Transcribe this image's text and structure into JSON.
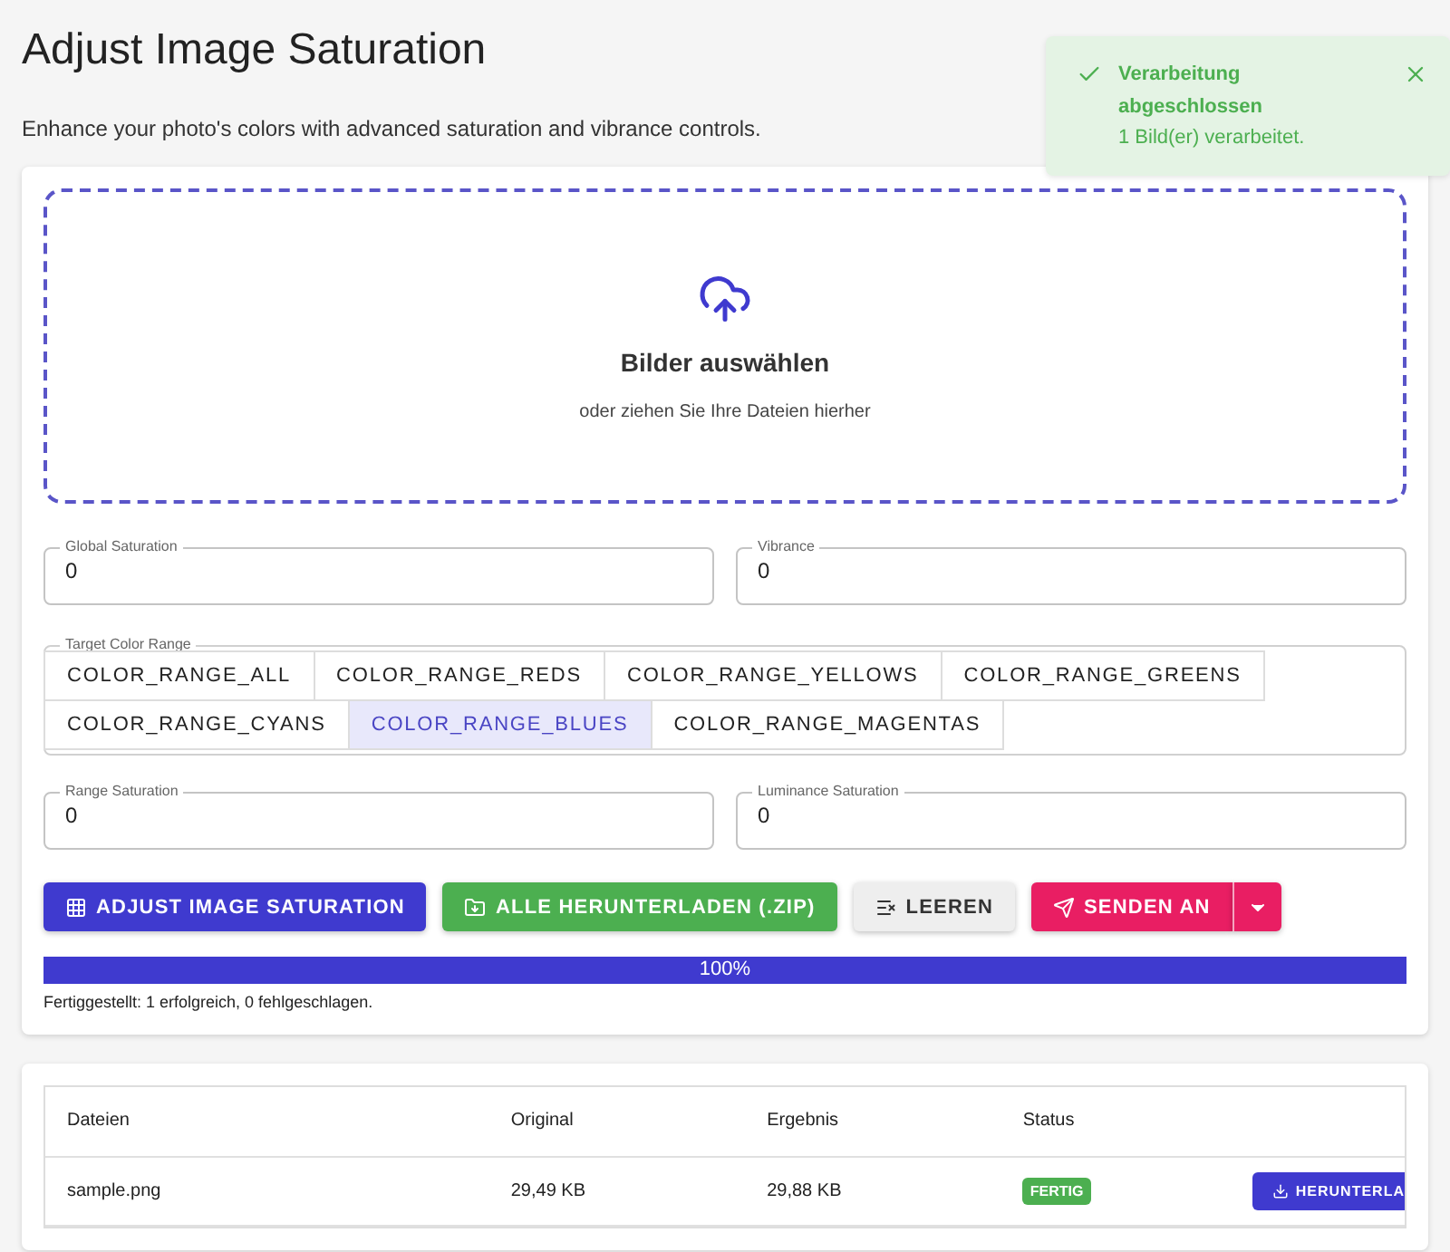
{
  "header": {
    "title": "Adjust Image Saturation",
    "subtitle": "Enhance your photo's colors with advanced saturation and vibrance controls."
  },
  "toast": {
    "title": "Verarbeitung abgeschlossen",
    "message": "1 Bild(er) verarbeitet."
  },
  "dropzone": {
    "title": "Bilder auswählen",
    "hint": "oder ziehen Sie Ihre Dateien hierher"
  },
  "fields_top": [
    {
      "label": "Global Saturation",
      "value": "0"
    },
    {
      "label": "Vibrance",
      "value": "0"
    }
  ],
  "color_range": {
    "label": "Target Color Range",
    "options": [
      {
        "label": "COLOR_RANGE_ALL",
        "selected": false
      },
      {
        "label": "COLOR_RANGE_REDS",
        "selected": false
      },
      {
        "label": "COLOR_RANGE_YELLOWS",
        "selected": false
      },
      {
        "label": "COLOR_RANGE_GREENS",
        "selected": false
      },
      {
        "label": "COLOR_RANGE_CYANS",
        "selected": false
      },
      {
        "label": "COLOR_RANGE_BLUES",
        "selected": true
      },
      {
        "label": "COLOR_RANGE_MAGENTAS",
        "selected": false
      }
    ]
  },
  "fields_bottom": [
    {
      "label": "Range Saturation",
      "value": "0"
    },
    {
      "label": "Luminance Saturation",
      "value": "0"
    }
  ],
  "actions": [
    {
      "kind": "primary",
      "label": "ADJUST IMAGE SATURATION"
    },
    {
      "kind": "zip",
      "label": "ALLE HERUNTERLADEN (.ZIP)"
    },
    {
      "kind": "clear",
      "label": "LEEREN"
    },
    {
      "kind": "send",
      "label": "SENDEN AN"
    }
  ],
  "progress": {
    "level": 1,
    "reading": "100%",
    "summary": "Fertiggestellt: 1 erfolgreich, 0 fehlgeschlagen."
  },
  "table": {
    "columns": [
      "Dateien",
      "Original",
      "Ergebnis",
      "Status"
    ],
    "rows": [
      {
        "file": "sample.png",
        "original": "29,49 KB",
        "result": "29,88 KB",
        "status": "FERTIG",
        "action": "HERUNTERLA"
      }
    ]
  }
}
